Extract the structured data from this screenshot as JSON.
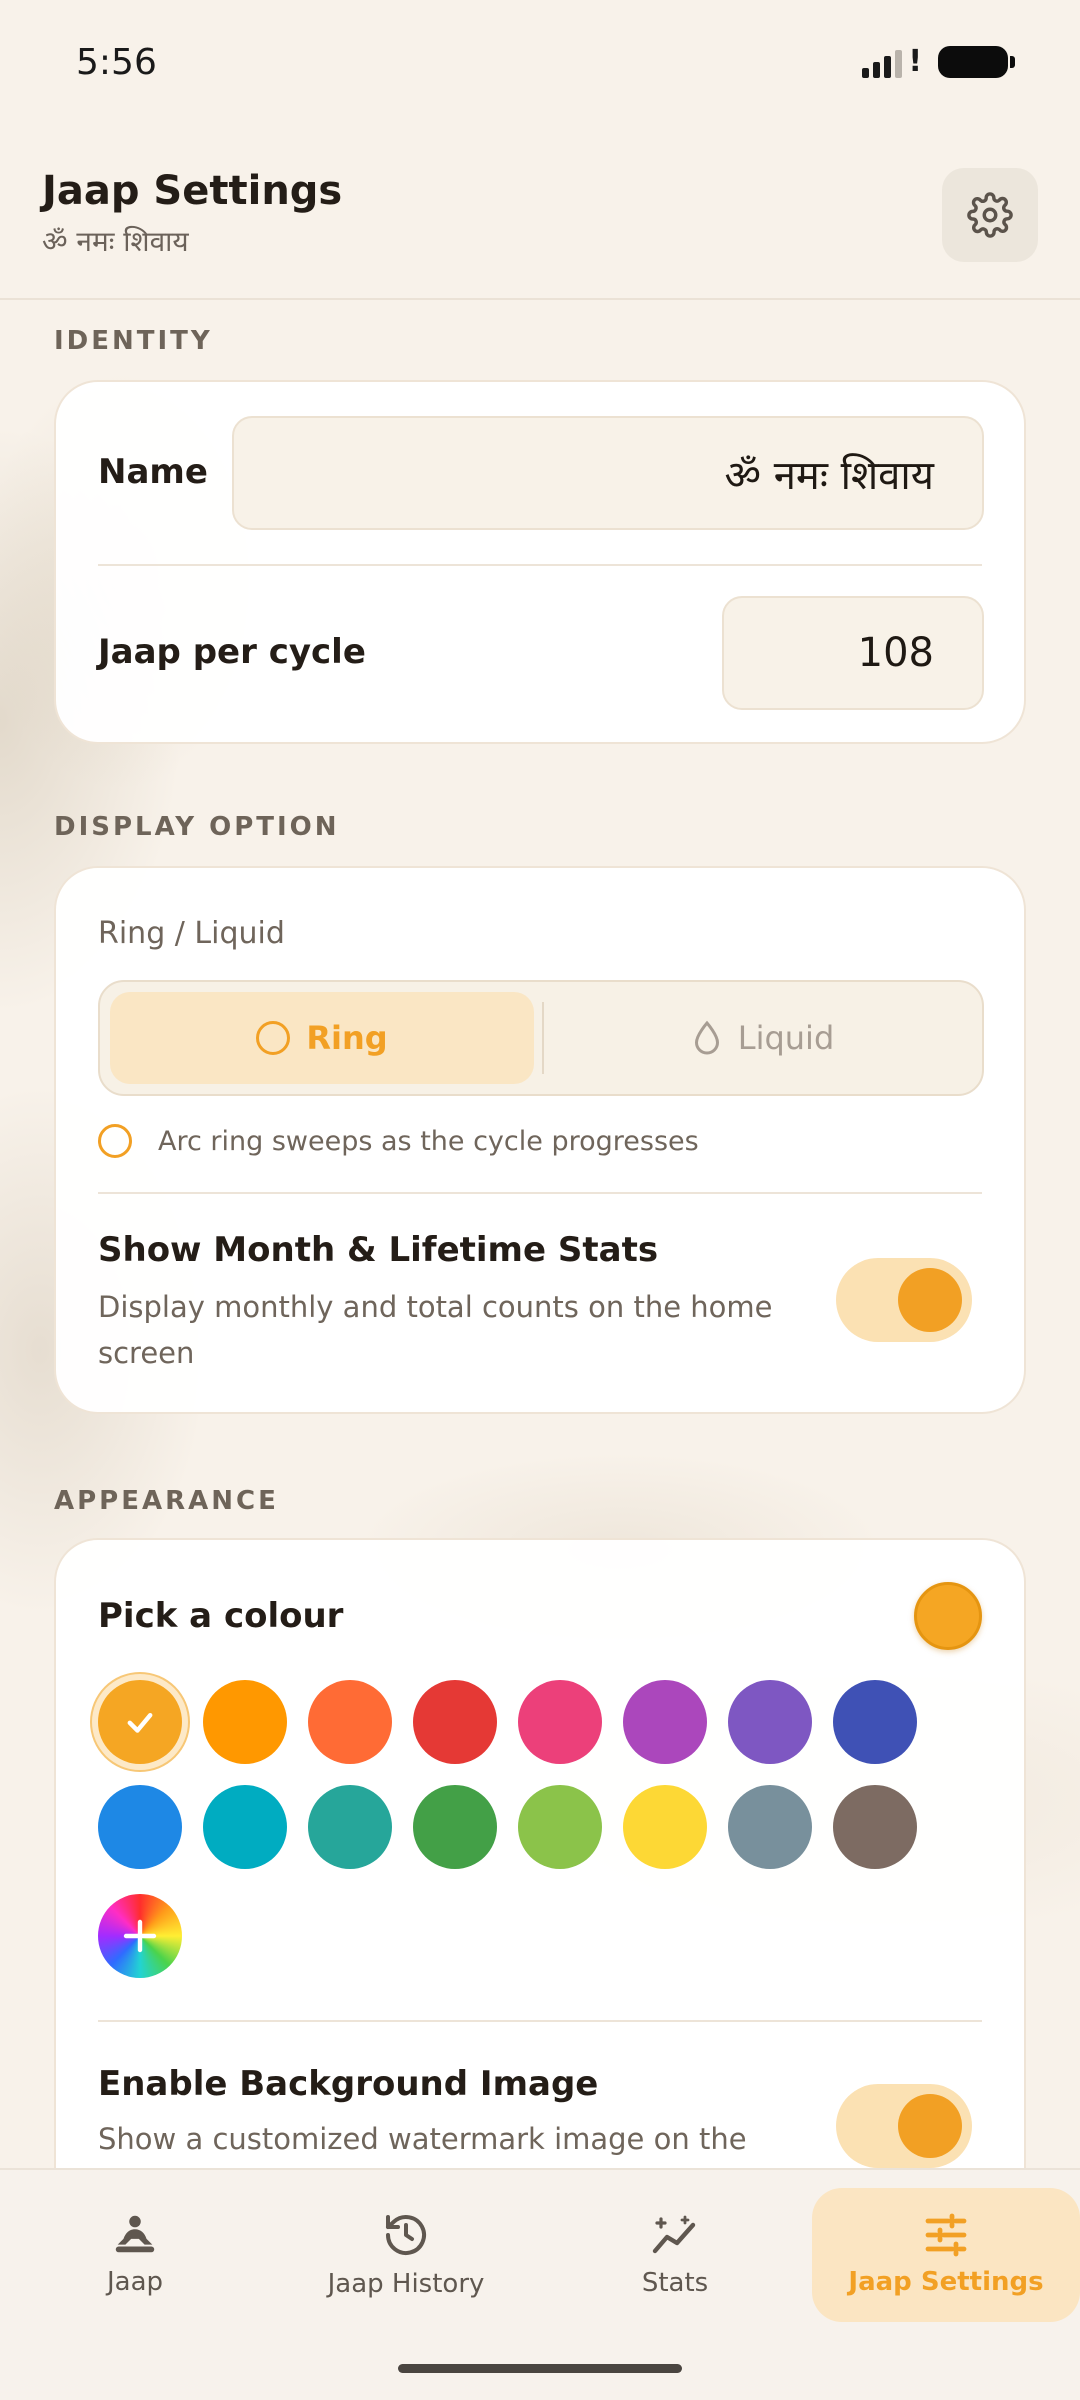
{
  "status_bar": {
    "time": "5:56"
  },
  "header": {
    "title": "Jaap Settings",
    "subtitle": "ॐ नमः शिवाय",
    "settings_icon": "gear-icon"
  },
  "identity": {
    "section_label": "IDENTITY",
    "name_label": "Name",
    "name_value": "ॐ नमः शिवाय",
    "cycle_label": "Jaap per cycle",
    "cycle_value": "108"
  },
  "display": {
    "section_label": "DISPLAY OPTION",
    "caption": "Ring / Liquid",
    "options": [
      {
        "label": "Ring",
        "icon": "ring-icon",
        "selected": true
      },
      {
        "label": "Liquid",
        "icon": "drop-icon",
        "selected": false
      }
    ],
    "hint": "Arc ring sweeps as the cycle progresses",
    "stats_toggle": {
      "title": "Show Month & Lifetime Stats",
      "description": "Display monthly and total counts on the home screen",
      "on": true
    }
  },
  "appearance": {
    "section_label": "APPEARANCE",
    "pick_title": "Pick a colour",
    "current_colour": "#F5A623",
    "colours": [
      "#F5A623",
      "#FF9800",
      "#FF6B35",
      "#E53935",
      "#EC407A",
      "#AB47BC",
      "#7E57C2",
      "#3F51B5",
      "#1E88E5",
      "#00ACC1",
      "#26A69A",
      "#43A047",
      "#8BC34A",
      "#FDD835",
      "#78909C",
      "#7D6B62"
    ],
    "selected_colour_index": 0,
    "custom_colour_icon": "colour-wheel-plus-icon",
    "bg_toggle": {
      "title": "Enable Background Image",
      "description": "Show a customized watermark image on the",
      "on": true
    }
  },
  "accent": "#F2A024",
  "nav": {
    "items": [
      {
        "label": "Jaap",
        "icon": "meditation-icon",
        "active": false
      },
      {
        "label": "Jaap History",
        "icon": "history-icon",
        "active": false
      },
      {
        "label": "Stats",
        "icon": "sparkle-chart-icon",
        "active": false
      },
      {
        "label": "Jaap Settings",
        "icon": "sliders-icon",
        "active": true
      }
    ]
  }
}
